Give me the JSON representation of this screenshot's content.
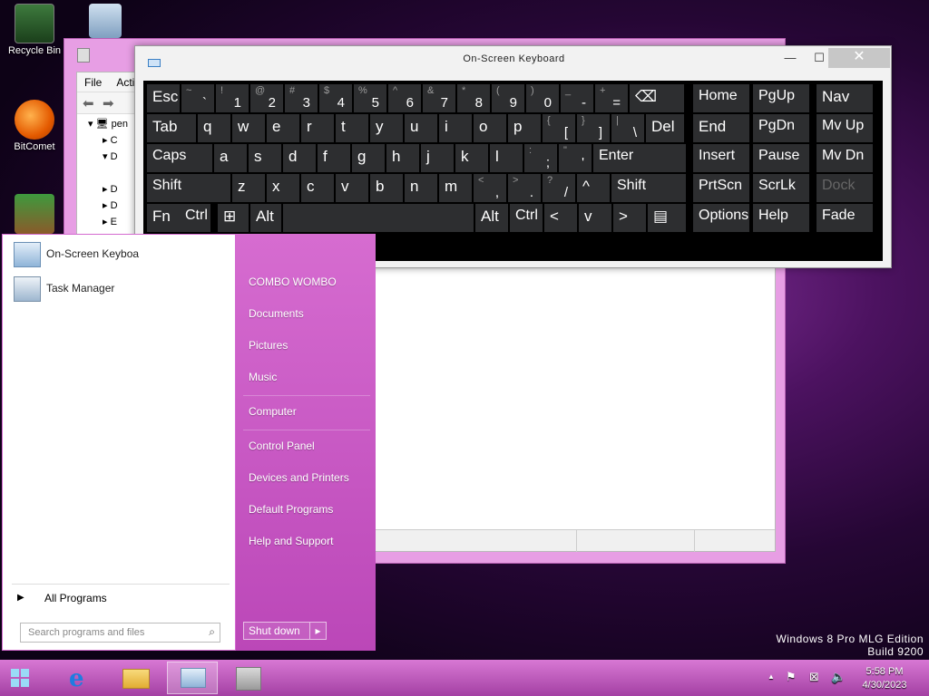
{
  "desktop": {
    "icons": [
      {
        "label": "Recycle Bin"
      },
      {
        "label": ""
      },
      {
        "label": "BitComet"
      },
      {
        "label": ""
      }
    ],
    "watermark_line1": "Windows 8 Pro MLG Edition",
    "watermark_line2": "Build 9200"
  },
  "explorer": {
    "menu": [
      "File",
      "Acti"
    ],
    "tree_items": [
      "pen",
      "C",
      "D",
      "D",
      "D",
      "E"
    ]
  },
  "osk": {
    "title": "On-Screen Keyboard",
    "rows": [
      [
        {
          "sub": "",
          "main": "Esc"
        },
        {
          "sub": "~",
          "main": "`"
        },
        {
          "sub": "!",
          "main": "1"
        },
        {
          "sub": "@",
          "main": "2"
        },
        {
          "sub": "#",
          "main": "3"
        },
        {
          "sub": "$",
          "main": "4"
        },
        {
          "sub": "%",
          "main": "5"
        },
        {
          "sub": "^",
          "main": "6"
        },
        {
          "sub": "&",
          "main": "7"
        },
        {
          "sub": "*",
          "main": "8"
        },
        {
          "sub": "(",
          "main": "9"
        },
        {
          "sub": ")",
          "main": "0"
        },
        {
          "sub": "_",
          "main": "-"
        },
        {
          "sub": "+",
          "main": "="
        },
        {
          "sub": "",
          "main": "⌫"
        },
        {
          "sub": "",
          "main": "Home"
        },
        {
          "sub": "",
          "main": "PgUp"
        },
        {
          "sub": "",
          "main": "Nav"
        }
      ],
      [
        {
          "sub": "",
          "main": "Tab"
        },
        {
          "sub": "",
          "main": "q"
        },
        {
          "sub": "",
          "main": "w"
        },
        {
          "sub": "",
          "main": "e"
        },
        {
          "sub": "",
          "main": "r"
        },
        {
          "sub": "",
          "main": "t"
        },
        {
          "sub": "",
          "main": "y"
        },
        {
          "sub": "",
          "main": "u"
        },
        {
          "sub": "",
          "main": "i"
        },
        {
          "sub": "",
          "main": "o"
        },
        {
          "sub": "",
          "main": "p"
        },
        {
          "sub": "{",
          "main": "["
        },
        {
          "sub": "}",
          "main": "]"
        },
        {
          "sub": "|",
          "main": "\\"
        },
        {
          "sub": "",
          "main": "Del"
        },
        {
          "sub": "",
          "main": "End"
        },
        {
          "sub": "",
          "main": "PgDn"
        },
        {
          "sub": "",
          "main": "Mv Up"
        }
      ],
      [
        {
          "sub": "",
          "main": "Caps"
        },
        {
          "sub": "",
          "main": "a"
        },
        {
          "sub": "",
          "main": "s"
        },
        {
          "sub": "",
          "main": "d"
        },
        {
          "sub": "",
          "main": "f"
        },
        {
          "sub": "",
          "main": "g"
        },
        {
          "sub": "",
          "main": "h"
        },
        {
          "sub": "",
          "main": "j"
        },
        {
          "sub": "",
          "main": "k"
        },
        {
          "sub": "",
          "main": "l"
        },
        {
          "sub": ":",
          "main": ";"
        },
        {
          "sub": "\"",
          "main": "'"
        },
        {
          "sub": "",
          "main": "Enter"
        },
        {
          "sub": "",
          "main": "Insert"
        },
        {
          "sub": "",
          "main": "Pause"
        },
        {
          "sub": "",
          "main": "Mv Dn"
        }
      ],
      [
        {
          "sub": "",
          "main": "Shift"
        },
        {
          "sub": "",
          "main": "z"
        },
        {
          "sub": "",
          "main": "x"
        },
        {
          "sub": "",
          "main": "c"
        },
        {
          "sub": "",
          "main": "v"
        },
        {
          "sub": "",
          "main": "b"
        },
        {
          "sub": "",
          "main": "n"
        },
        {
          "sub": "",
          "main": "m"
        },
        {
          "sub": "<",
          "main": ","
        },
        {
          "sub": ">",
          "main": "."
        },
        {
          "sub": "?",
          "main": "/"
        },
        {
          "sub": "",
          "main": "^"
        },
        {
          "sub": "",
          "main": "Shift"
        },
        {
          "sub": "",
          "main": "PrtScn"
        },
        {
          "sub": "",
          "main": "ScrLk"
        },
        {
          "sub": "",
          "main": "Dock"
        }
      ],
      [
        {
          "sub": "",
          "main": "Fn"
        },
        {
          "sub": "",
          "main": "Ctrl"
        },
        {
          "sub": "",
          "main": "⊞"
        },
        {
          "sub": "",
          "main": "Alt"
        },
        {
          "sub": "",
          "main": ""
        },
        {
          "sub": "",
          "main": "Alt"
        },
        {
          "sub": "",
          "main": "Ctrl"
        },
        {
          "sub": "",
          "main": "<"
        },
        {
          "sub": "",
          "main": "v"
        },
        {
          "sub": "",
          "main": ">"
        },
        {
          "sub": "",
          "main": "▤"
        },
        {
          "sub": "",
          "main": "Options"
        },
        {
          "sub": "",
          "main": "Help"
        },
        {
          "sub": "",
          "main": "Fade"
        }
      ]
    ]
  },
  "start_menu": {
    "programs": [
      "On-Screen Keyboa",
      "Task Manager"
    ],
    "all_programs": "All Programs",
    "search_placeholder": "Search programs and files",
    "links": [
      "COMBO WOMBO",
      "Documents",
      "Pictures",
      "Music",
      "Computer",
      "Control Panel",
      "Devices and Printers",
      "Default Programs",
      "Help and Support"
    ],
    "shutdown_label": "Shut down"
  },
  "taskbar": {
    "time": "5:58 PM",
    "date": "4/30/2023"
  },
  "colors": {
    "accent": "#c94fc5",
    "key_bg": "#2d2e30",
    "close": "#c7c7c7"
  }
}
